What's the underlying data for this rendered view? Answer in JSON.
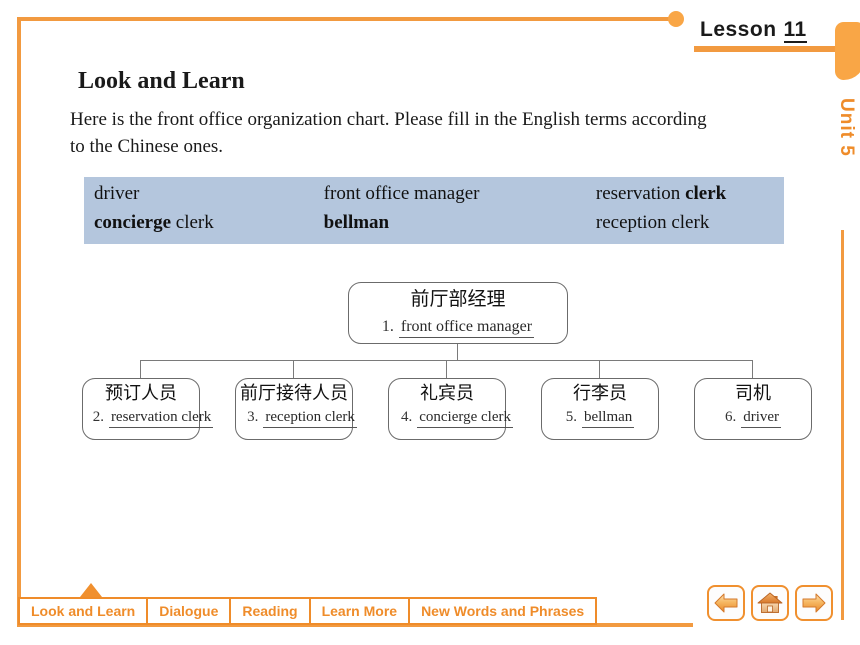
{
  "header": {
    "lesson_label": "Lesson",
    "lesson_number": "11",
    "unit_label": "Unit 5"
  },
  "main": {
    "section_title": "Look and Learn",
    "instruction": "Here is the front office organization chart. Please fill in the English terms according to the Chinese ones."
  },
  "word_bank": {
    "rows": [
      [
        {
          "plain_before": "driver",
          "bold": "",
          "plain_after": ""
        },
        {
          "plain_before": "front office manager",
          "bold": "",
          "plain_after": ""
        },
        {
          "plain_before": "reservation ",
          "bold": "clerk",
          "plain_after": ""
        }
      ],
      [
        {
          "plain_before": "",
          "bold": "concierge",
          "plain_after": " clerk"
        },
        {
          "plain_before": "",
          "bold": "bellman",
          "plain_after": ""
        },
        {
          "plain_before": "reception clerk",
          "bold": "",
          "plain_after": ""
        }
      ]
    ],
    "items_flat": [
      "driver",
      "front office manager",
      "reservation clerk",
      "concierge clerk",
      "bellman",
      "reception clerk"
    ],
    "background_color": "#b4c6dd"
  },
  "org_chart": {
    "top": {
      "chinese": "前厅部经理",
      "number": "1.",
      "answer": "front office manager"
    },
    "children": [
      {
        "chinese": "预订人员",
        "number": "2.",
        "answer": "reservation clerk"
      },
      {
        "chinese": "前厅接待人员",
        "number": "3.",
        "answer": "reception clerk"
      },
      {
        "chinese": "礼宾员",
        "number": "4.",
        "answer": "concierge clerk"
      },
      {
        "chinese": "行李员",
        "number": "5.",
        "answer": "bellman"
      },
      {
        "chinese": "司机",
        "number": "6.",
        "answer": "driver"
      }
    ]
  },
  "tabs": [
    {
      "label": "Look and Learn",
      "active": true
    },
    {
      "label": "Dialogue",
      "active": false
    },
    {
      "label": "Reading",
      "active": false
    },
    {
      "label": "Learn More",
      "active": false
    },
    {
      "label": "New Words and Phrases",
      "active": false
    }
  ],
  "nav_buttons": [
    {
      "icon": "back-arrow-icon",
      "name": "previous-slide-button"
    },
    {
      "icon": "home-icon",
      "name": "home-button"
    },
    {
      "icon": "forward-arrow-icon",
      "name": "next-slide-button"
    }
  ],
  "theme": {
    "accent_orange": "#f0902f",
    "accent_orange_light": "#f9a646",
    "wordbank_blue": "#b4c6dd",
    "text_dark": "#1a1a1a",
    "node_border": "#6b6b6b"
  }
}
